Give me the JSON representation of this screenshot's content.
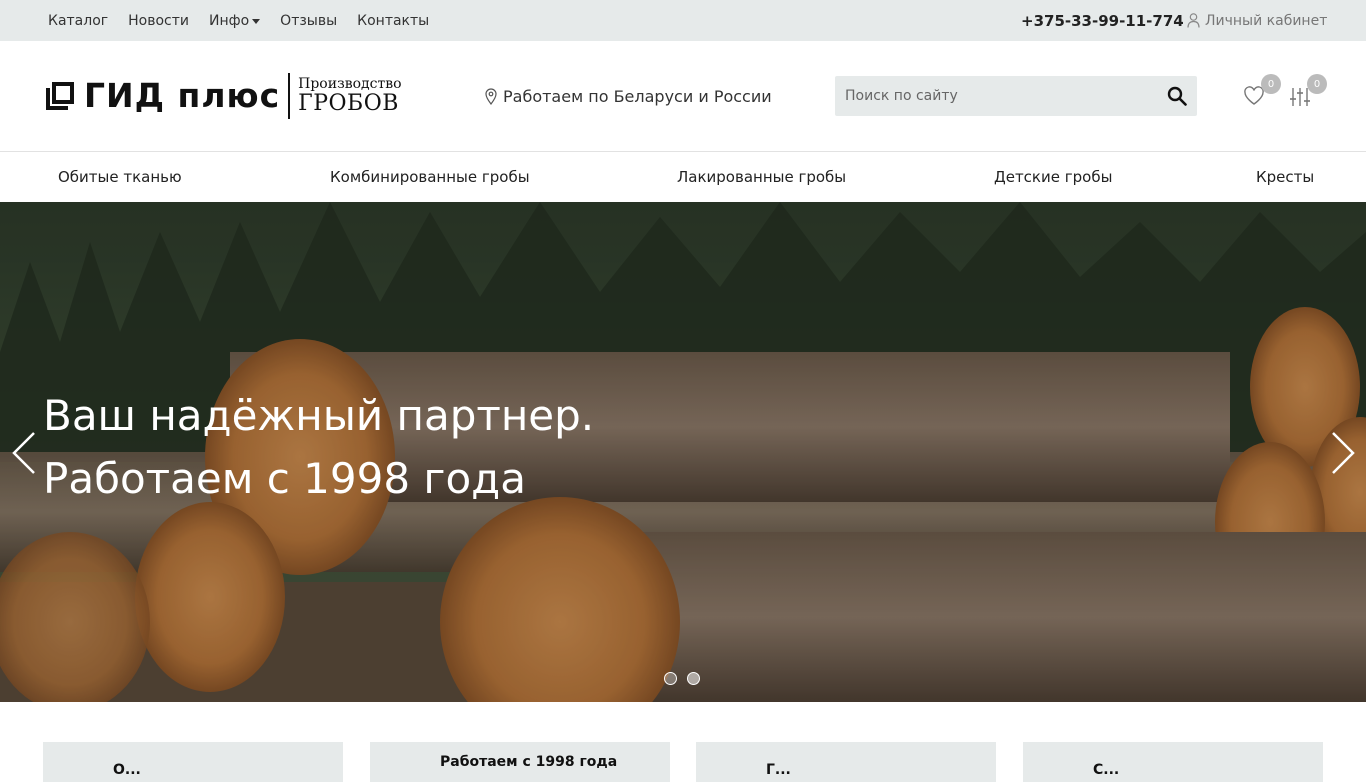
{
  "topbar": {
    "nav": [
      {
        "label": "Каталог"
      },
      {
        "label": "Новости"
      },
      {
        "label": "Инфо",
        "has_dropdown": true
      },
      {
        "label": "Отзывы"
      },
      {
        "label": "Контакты"
      }
    ],
    "phone": "+375-33-99-11-774",
    "account_label": "Личный кабинет",
    "account_icon": "user-icon"
  },
  "header": {
    "logo_name": "ГИД плюс",
    "logo_sub_1": "Производство",
    "logo_sub_2": "ГРОБОВ",
    "location": "Работаем по Беларуси и России",
    "location_icon": "map-pin-icon",
    "search_placeholder": "Поиск по сайту",
    "search_icon": "search-icon",
    "favorites_count": "0",
    "favorites_icon": "heart-icon",
    "compare_count": "0",
    "compare_icon": "sliders-icon"
  },
  "categories": [
    {
      "label": "Обитые тканью"
    },
    {
      "label": "Комбинированные гробы"
    },
    {
      "label": "Лакированные гробы"
    },
    {
      "label": "Детские гробы"
    },
    {
      "label": "Кресты"
    }
  ],
  "hero": {
    "title_line_1": "Ваш надёжный партнер.",
    "title_line_2": "Работаем с 1998 года",
    "slides_total": 2,
    "active_slide": 2,
    "prev_icon": "chevron-left-icon",
    "next_icon": "chevron-right-icon"
  },
  "cards": [
    {
      "title": "О..."
    },
    {
      "title": "Работаем с 1998 года"
    },
    {
      "title": "Г..."
    },
    {
      "title": "С..."
    }
  ],
  "colors": {
    "topbar_bg": "#e6eaea",
    "search_bg": "#e6eaea",
    "badge": "#bbbbbb"
  }
}
